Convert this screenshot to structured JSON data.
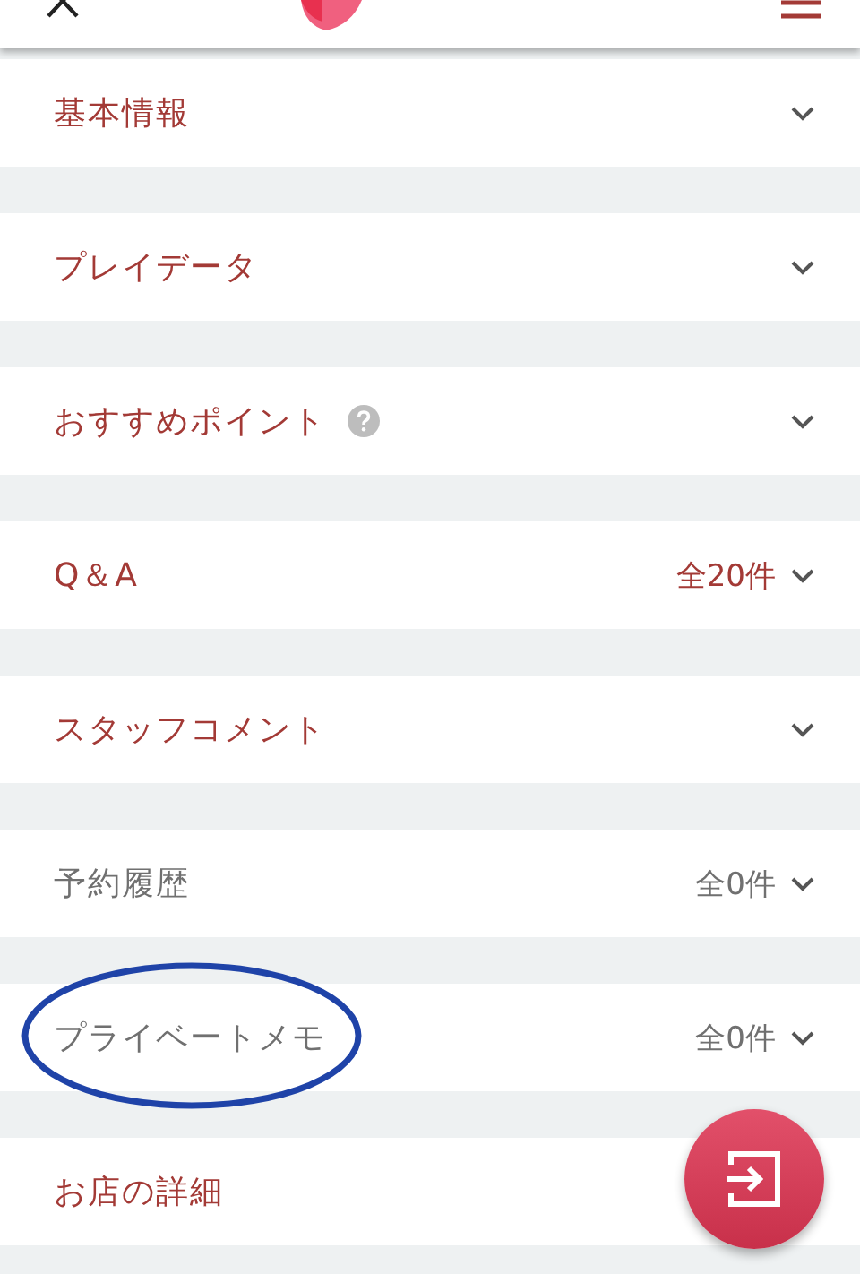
{
  "sections": [
    {
      "label": "基本情報",
      "disabled": false,
      "help": false
    },
    {
      "label": "プレイデータ",
      "disabled": false,
      "help": false
    },
    {
      "label": "おすすめポイント",
      "disabled": false,
      "help": true
    },
    {
      "label": "Q＆A",
      "count": "全20件",
      "disabled": false,
      "help": false
    },
    {
      "label": "スタッフコメント",
      "disabled": false,
      "help": false
    },
    {
      "label": "予約履歴",
      "count": "全0件",
      "disabled": true,
      "help": false
    },
    {
      "label": "プライベートメモ",
      "count": "全0件",
      "disabled": true,
      "help": false,
      "circled": true
    },
    {
      "label": "お店の詳細",
      "disabled": false,
      "help": false
    }
  ],
  "fab": {
    "kind": "login"
  }
}
